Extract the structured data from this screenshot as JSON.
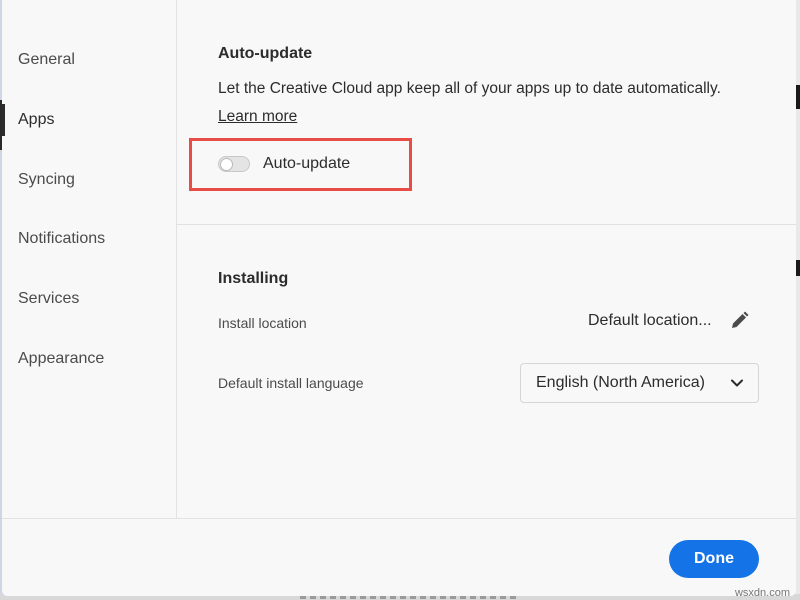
{
  "sidebar": {
    "items": [
      {
        "label": "General",
        "active": false
      },
      {
        "label": "Apps",
        "active": true
      },
      {
        "label": "Syncing",
        "active": false
      },
      {
        "label": "Notifications",
        "active": false
      },
      {
        "label": "Services",
        "active": false
      },
      {
        "label": "Appearance",
        "active": false
      }
    ]
  },
  "auto_update": {
    "title": "Auto-update",
    "description": "Let the Creative Cloud app keep all of your apps up to date automatically.",
    "learn_more": "Learn more",
    "toggle_label": "Auto-update",
    "toggle_on": false,
    "highlight_color": "#e74c47"
  },
  "installing": {
    "title": "Installing",
    "location_label": "Install location",
    "location_value": "Default location...",
    "location_icon": "pencil-icon",
    "language_label": "Default install language",
    "language_value": "English (North America)",
    "language_icon": "chevron-down-icon"
  },
  "footer": {
    "done_label": "Done",
    "accent": "#1473e6"
  },
  "watermark": "wsxdn.com"
}
